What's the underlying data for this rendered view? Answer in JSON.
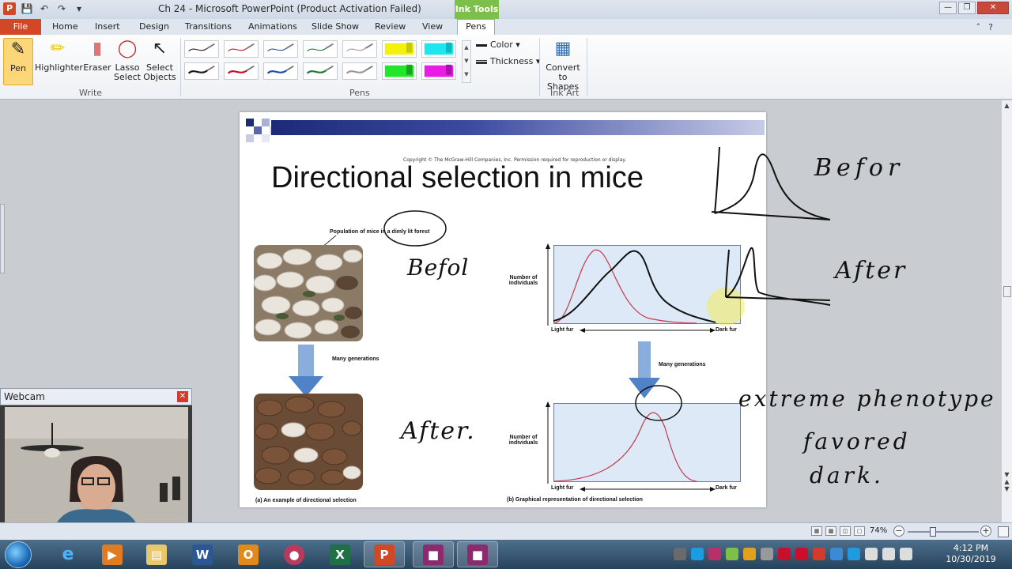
{
  "window": {
    "title": "Ch 24  -  Microsoft PowerPoint (Product Activation Failed)",
    "context_tab_group": "Ink Tools"
  },
  "tabs": [
    "File",
    "Home",
    "Insert",
    "Design",
    "Transitions",
    "Animations",
    "Slide Show",
    "Review",
    "View",
    "Pens"
  ],
  "ribbon": {
    "write": {
      "pen": "Pen",
      "highlighter": "Highlighter",
      "eraser": "Eraser",
      "lasso_line1": "Lasso",
      "lasso_line2": "Select",
      "select_line1": "Select",
      "select_line2": "Objects",
      "group": "Write"
    },
    "pens": {
      "group": "Pens",
      "color": "Color",
      "thickness": "Thickness",
      "swatches_top": [
        "#1a1a1a",
        "#c8102e",
        "#1f4fa8",
        "#1c7a3a",
        "#9a9a9a",
        "#f4f10c",
        "#1ce6f0"
      ],
      "swatches_bottom": [
        "#1a1a1a",
        "#c8102e",
        "#1f4fa8",
        "#1c7a3a",
        "#9a9a9a",
        "#21e62a",
        "#e91ce6"
      ]
    },
    "ink_art": {
      "convert_line1": "Convert",
      "convert_line2": "to Shapes",
      "group": "Ink Art"
    }
  },
  "slide": {
    "copyright": "Copyright © The McGraw-Hill Companies, Inc. Permission required for reproduction or display.",
    "title": "Directional selection in mice",
    "population_label": "Population of mice in a dimly lit forest",
    "many_generations_left": "Many generations",
    "many_generations_right": "Many generations",
    "caption_a": "(a) An example of directional selection",
    "caption_b": "(b) Graphical representation of directional selection",
    "y_label_line1": "Number of",
    "y_label_line2": "individuals",
    "x_left": "Light fur",
    "x_right": "Dark fur"
  },
  "annotations": {
    "before_slide": "Befol",
    "after_slide": "After.",
    "before_margin": "Befor",
    "after_margin": "After",
    "extreme": "extreme phenotype",
    "favored": "favored",
    "dark": "dark."
  },
  "webcam": {
    "title": "Webcam"
  },
  "status": {
    "zoom": "74%"
  },
  "taskbar": {
    "time": "4:12 PM",
    "date": "10/30/2019"
  }
}
